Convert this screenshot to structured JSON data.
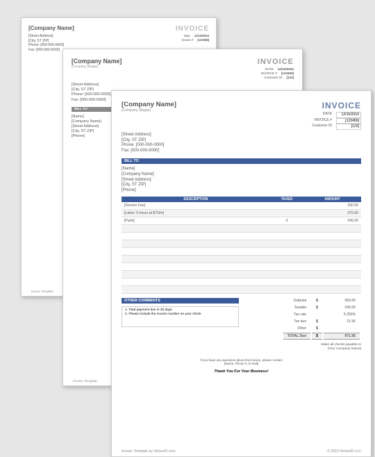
{
  "company": {
    "name": "[Company Name]",
    "slogan": "[Company Slogan]"
  },
  "addr": {
    "street": "[Street Address]",
    "city": "[City, ST  ZIP]",
    "phone": "Phone: [000-000-0000]",
    "fax": "Fax: [000-000-0000]"
  },
  "inv": {
    "title": "INVOICE"
  },
  "meta1": {
    "date_lbl": "Date",
    "date": "12/10/2010",
    "num_lbl": "Invoice #",
    "num": "[123456]"
  },
  "meta2": {
    "date_lbl": "DATE",
    "date": "12/10/2010",
    "num_lbl": "INVOICE #",
    "num": "[123456]",
    "cust_lbl": "Customer ID",
    "cust": "[123]"
  },
  "meta3": {
    "date_lbl": "DATE",
    "date": "12/10/2010",
    "num_lbl": "INVOICE #",
    "num": "[123456]",
    "cust_lbl": "Customer ID",
    "cust": "[123]"
  },
  "billto_lbl": "BILL TO",
  "billto": {
    "name": "[Name]",
    "co": "[Company Name]",
    "street": "[Street Address]",
    "city": "[City, ST  ZIP]",
    "phone": "[Phone]"
  },
  "cols": {
    "desc": "DESCRIPTION",
    "taxed": "TAXED",
    "amount": "AMOUNT"
  },
  "items": [
    {
      "desc": "[Service Fee]",
      "taxed": "",
      "amount": "200.00"
    },
    {
      "desc": "[Labor: 5 hours at $75/hr]",
      "taxed": "",
      "amount": "375.00"
    },
    {
      "desc": "[Parts]",
      "taxed": "X",
      "amount": "345.00"
    }
  ],
  "other_lbl": "OTHER COMMENTS",
  "comments": {
    "l1": "1. Total payment due in 30 days",
    "l2": "2. Please include the invoice number on your check"
  },
  "totals": {
    "subtotal_lbl": "Subtotal",
    "subtotal": "950.00",
    "taxable_lbl": "Taxable",
    "taxable": "345.00",
    "rate_lbl": "Tax rate",
    "rate": "6.250%",
    "tax_lbl": "Tax due",
    "tax": "21.56",
    "other_lbl": "Other",
    "other": "-",
    "total_lbl": "TOTAL Due",
    "total": "971.56",
    "cur": "$"
  },
  "payable": {
    "l1": "Make all checks payable to",
    "l2": "[Your Company Name]"
  },
  "foot": {
    "q1": "If you have any questions about this invoice, please contact",
    "q2": "[Name, Phone #, E-mail]"
  },
  "thx": "Thank You For Your Business!",
  "credit": {
    "left": "Invoice Template by Vertex42.com",
    "right": "© 2010 Vertex42 LLC",
    "left_short": "Invoice Template"
  }
}
